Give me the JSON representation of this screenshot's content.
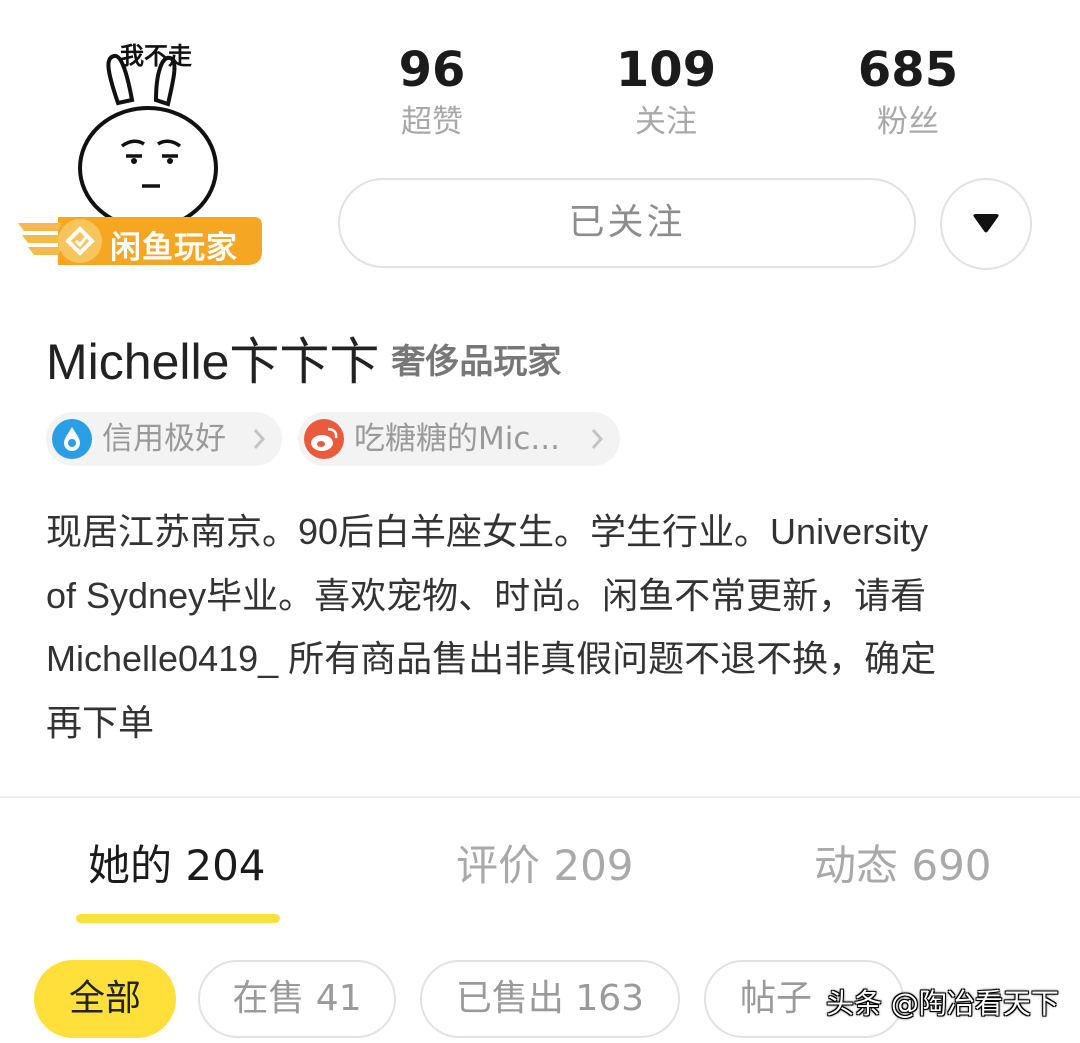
{
  "profile": {
    "avatar_caption": "我不走",
    "badge": "闲鱼玩家",
    "name": "Michelle卞卞卞",
    "tag": "奢侈品玩家"
  },
  "stats": [
    {
      "value": "96",
      "label": "超赞"
    },
    {
      "value": "109",
      "label": "关注"
    },
    {
      "value": "685",
      "label": "粉丝"
    }
  ],
  "follow_button": "已关注",
  "chips": {
    "credit": "信用极好",
    "weibo": "吃糖糖的Mic..."
  },
  "bio_lines": [
    "现居江苏南京。90后白羊座女生。学生行业。University",
    "of Sydney毕业。喜欢宠物、时尚。闲鱼不常更新，请看",
    "Michelle0419_ 所有商品售出非真假问题不退不换，确定",
    "再下单"
  ],
  "tabs": [
    {
      "label": "她的 204"
    },
    {
      "label": "评价 209"
    },
    {
      "label": "动态 690"
    }
  ],
  "filters": [
    {
      "label": "全部"
    },
    {
      "label": "在售 41"
    },
    {
      "label": "已售出 163"
    },
    {
      "label": "帖子"
    }
  ],
  "watermark": "头条 @陶冶看天下",
  "colors": {
    "accent": "#ffe03a",
    "badge": "#f5a623",
    "credit_icon": "#2a9fe6",
    "weibo_icon": "#ea5a3c"
  }
}
